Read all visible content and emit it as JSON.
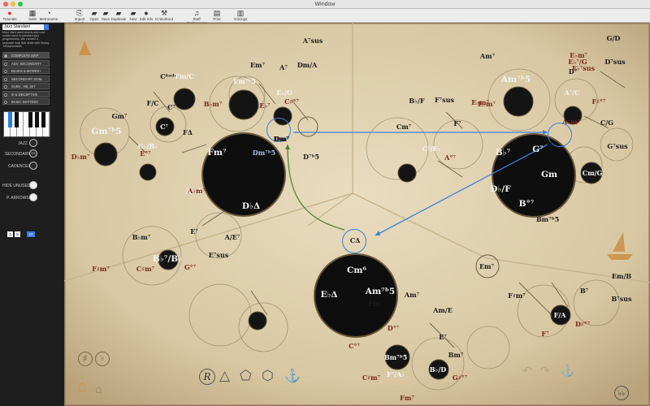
{
  "window": {
    "title": "Window"
  },
  "toolbar": {
    "items": [
      {
        "label": "Tutorials",
        "icon": "tutorial-icon"
      },
      {
        "label": "Salts",
        "icon": "salts-icon"
      },
      {
        "label": "Metronome",
        "icon": "metronome-icon"
      },
      {
        "label": "Import Book",
        "icon": "import-icon"
      },
      {
        "label": "Open",
        "icon": "folder-open-icon"
      },
      {
        "label": "Save",
        "icon": "save-icon"
      },
      {
        "label": "Duplicate",
        "icon": "duplicate-icon"
      },
      {
        "label": "New",
        "icon": "new-icon"
      },
      {
        "label": "Edit Info",
        "icon": "edit-info-icon"
      },
      {
        "label": "to Workout",
        "icon": "workout-icon"
      },
      {
        "label": "Staff Preferences",
        "icon": "staff-icon"
      },
      {
        "label": "Print",
        "icon": "print-icon"
      },
      {
        "label": "Voicings",
        "icon": "voicings-icon"
      }
    ]
  },
  "sidebar": {
    "style_select": "Jazz Standard",
    "description": "Most often used chords and cord scales used in standard jazz progressions. We created a separate map that deals with bluesy \"idiosyncrasies.",
    "maps": [
      {
        "label": "COMPLETE MAP",
        "selected": true
      },
      {
        "label": "ADV. SECONDARY",
        "selected": false
      },
      {
        "label": "BLUES & MODES+",
        "selected": false
      },
      {
        "label": "SECONDARY DOM.",
        "selected": false
      },
      {
        "label": "SUBV., HB, bII7",
        "selected": false
      },
      {
        "label": "III & DECEPTIVE",
        "selected": false
      },
      {
        "label": "BASIC DIATONIC",
        "selected": false
      }
    ],
    "jazz_label": "JAZZ",
    "secondary_label": "SECONDARY",
    "secondary_value": "7/6",
    "cadences_label": "CADENCES",
    "hide_unused_label": "HIDE UNUSED",
    "p_arrows_label": "P. ARROWS",
    "counters": [
      "3",
      "5",
      "10"
    ]
  },
  "map": {
    "chords": [
      {
        "t": "C⁶ᵃᵈᵈ",
        "c": "n"
      },
      {
        "t": "Fm/C",
        "c": "w"
      },
      {
        "t": "F/C",
        "c": "n"
      },
      {
        "t": "C⁷",
        "c": "n"
      },
      {
        "t": "Gm⁷",
        "c": "n"
      },
      {
        "t": "Gm⁷ᵇ5",
        "c": "w"
      },
      {
        "t": "C⁷",
        "c": "w"
      },
      {
        "t": "G♭/B♭",
        "c": "w"
      },
      {
        "t": "D♭m⁷",
        "c": "r"
      },
      {
        "t": "E°⁷",
        "c": "r"
      },
      {
        "t": "FΔ",
        "c": "n"
      },
      {
        "t": "Em⁷",
        "c": "n"
      },
      {
        "t": "Em⁷ᵇ5",
        "c": "w"
      },
      {
        "t": "B♭m⁷",
        "c": "r"
      },
      {
        "t": "E♭/G",
        "c": "w"
      },
      {
        "t": "E♭⁷",
        "c": "r"
      },
      {
        "t": "A⁷",
        "c": "n"
      },
      {
        "t": "A⁷sus",
        "c": "n"
      },
      {
        "t": "Dm/A",
        "c": "n"
      },
      {
        "t": "C♯°⁷",
        "c": "r"
      },
      {
        "t": "Dm⁷",
        "c": "n"
      },
      {
        "t": "D⁷ᵇ5",
        "c": "n"
      },
      {
        "t": "Fm⁷",
        "c": "w"
      },
      {
        "t": "Dm⁷ᵇ5",
        "c": "b"
      },
      {
        "t": "A♭Δ",
        "c": "w"
      },
      {
        "t": "D♭Δ",
        "c": "w"
      },
      {
        "t": "A♭m⁷",
        "c": "r"
      },
      {
        "t": "B♭m⁷",
        "c": "n"
      },
      {
        "t": "B♭⁷/B♭",
        "c": "w"
      },
      {
        "t": "E⁷",
        "c": "n"
      },
      {
        "t": "A/E⁷",
        "c": "n"
      },
      {
        "t": "E⁷sus",
        "c": "n"
      },
      {
        "t": "F♯m⁷",
        "c": "r"
      },
      {
        "t": "C♯m⁷",
        "c": "r"
      },
      {
        "t": "G°⁷",
        "c": "r"
      },
      {
        "t": "Cm⁷",
        "c": "n"
      },
      {
        "t": "C¹/E♭",
        "c": "w"
      },
      {
        "t": "F⁷",
        "c": "n"
      },
      {
        "t": "F⁷sus",
        "c": "n"
      },
      {
        "t": "B♭/F",
        "c": "n"
      },
      {
        "t": "A°⁷",
        "c": "r"
      },
      {
        "t": "E♭m⁷",
        "c": "r"
      },
      {
        "t": "B♭⁷",
        "c": "w"
      },
      {
        "t": "G⁷",
        "c": "w"
      },
      {
        "t": "D♭/F",
        "c": "w"
      },
      {
        "t": "Gm",
        "c": "w"
      },
      {
        "t": "B°⁷",
        "c": "w"
      },
      {
        "t": "Bm⁷ᵇ5",
        "c": "n"
      },
      {
        "t": "Am⁷",
        "c": "n"
      },
      {
        "t": "Am⁷ᵇ5",
        "c": "w"
      },
      {
        "t": "D⁷",
        "c": "n"
      },
      {
        "t": "A⁷/C",
        "c": "w"
      },
      {
        "t": "G/D",
        "c": "n"
      },
      {
        "t": "D⁷sus",
        "c": "n"
      },
      {
        "t": "E♭m⁷",
        "c": "r"
      },
      {
        "t": "A♭m⁷",
        "c": "r"
      },
      {
        "t": "F♯°⁷",
        "c": "r"
      },
      {
        "t": "C/G",
        "c": "n"
      },
      {
        "t": "G⁷sus",
        "c": "n"
      },
      {
        "t": "Cm/G",
        "c": "w"
      },
      {
        "t": "Cm⁶",
        "c": "w"
      },
      {
        "t": "E♭Δ",
        "c": "w"
      },
      {
        "t": "Am⁷ᵇ5",
        "c": "w"
      },
      {
        "t": "Am⁷",
        "c": "n"
      },
      {
        "t": "C°⁷",
        "c": "r"
      },
      {
        "t": "Fm⁷",
        "c": "n"
      },
      {
        "t": "F⁷/A♭",
        "c": "w"
      },
      {
        "t": "D°⁷",
        "c": "r"
      },
      {
        "t": "C♯m⁷",
        "c": "r"
      },
      {
        "t": "Am/E",
        "c": "n"
      },
      {
        "t": "E⁷",
        "c": "n"
      },
      {
        "t": "Bm⁷",
        "c": "n"
      },
      {
        "t": "Bm⁷ᵇ5",
        "c": "w"
      },
      {
        "t": "B♭/D",
        "c": "w"
      },
      {
        "t": "Fm⁷",
        "c": "r"
      },
      {
        "t": "G♯°⁷",
        "c": "r"
      },
      {
        "t": "E♭m⁷",
        "c": "r"
      },
      {
        "t": "E♭⁷/G",
        "c": "r"
      },
      {
        "t": "E♭⁷sus",
        "c": "r"
      },
      {
        "t": "Em⁷",
        "c": "n"
      },
      {
        "t": "F♯m⁷",
        "c": "n"
      },
      {
        "t": "B⁷",
        "c": "n"
      },
      {
        "t": "Em/B",
        "c": "n"
      },
      {
        "t": "B⁷sus",
        "c": "n"
      },
      {
        "t": "F/A",
        "c": "w"
      },
      {
        "t": "F⁷",
        "c": "r"
      },
      {
        "t": "D♯°⁷",
        "c": "r"
      },
      {
        "t": "Dm⁷",
        "c": "n"
      },
      {
        "t": "G⁷",
        "c": "n"
      },
      {
        "t": "CΔ",
        "c": "n"
      }
    ]
  },
  "bottom": {
    "home_icon": "home-icon",
    "flat_label": "♭",
    "sharp_label": "♯",
    "mode_label": "R",
    "bb_label": "♭♭"
  }
}
